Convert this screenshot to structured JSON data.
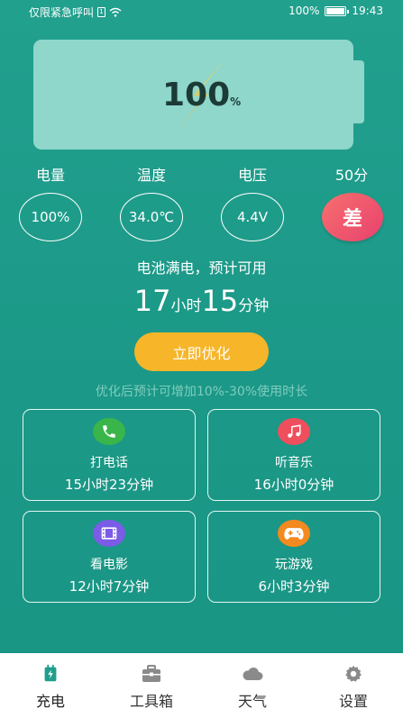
{
  "status_bar": {
    "carrier": "仅限紧急呼叫",
    "sim_label": "1",
    "battery": "100%",
    "time": "19:43"
  },
  "battery_display": {
    "level_value": "100",
    "level_unit": "%"
  },
  "stats": {
    "power": {
      "label": "电量",
      "value": "100%"
    },
    "temperature": {
      "label": "温度",
      "value": "34.0℃"
    },
    "voltage": {
      "label": "电压",
      "value": "4.4V"
    },
    "score": {
      "label": "50分",
      "grade": "差"
    }
  },
  "remaining": {
    "status_text": "电池满电，预计可用",
    "hours": "17",
    "hours_unit": "小时",
    "minutes": "15",
    "minutes_unit": "分钟"
  },
  "optimize": {
    "button_label": "立即优化",
    "hint": "优化后预计可增加10%-30%使用时长"
  },
  "usage_cards": [
    {
      "title": "打电话",
      "time": "15小时23分钟",
      "icon": "phone-icon",
      "color": "#3ab54a"
    },
    {
      "title": "听音乐",
      "time": "16小时0分钟",
      "icon": "music-icon",
      "color": "#ef4f5c"
    },
    {
      "title": "看电影",
      "time": "12小时7分钟",
      "icon": "film-icon",
      "color": "#7b5ce6"
    },
    {
      "title": "玩游戏",
      "time": "6小时3分钟",
      "icon": "gamepad-icon",
      "color": "#f38a1f"
    }
  ],
  "tabs": [
    {
      "label": "充电",
      "icon": "charging-icon",
      "active": true
    },
    {
      "label": "工具箱",
      "icon": "toolbox-icon"
    },
    {
      "label": "天气",
      "icon": "cloud-icon"
    },
    {
      "label": "设置",
      "icon": "gear-icon"
    }
  ],
  "colors": {
    "background": "#1f9e8c",
    "battery_fill": "#8fd6cb",
    "accent_button": "#f7b52a",
    "grade_badge": "#e8416e",
    "active_tab_icon": "#1f9e8c",
    "inactive_tab_icon": "#8a8a8a"
  }
}
